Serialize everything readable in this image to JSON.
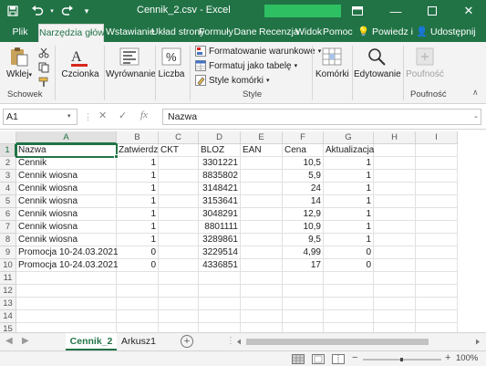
{
  "window": {
    "title": "Cennik_2.csv  -  Excel",
    "brand_color": "#217346"
  },
  "quick_access": {
    "save_icon": "save-icon",
    "undo_icon": "undo-icon",
    "redo_icon": "redo-icon",
    "customize_icon": "customize-quick-access-icon"
  },
  "ribbon_tabs": [
    {
      "label": "Plik",
      "active": false
    },
    {
      "label": "Narzędzia główne",
      "active": true
    },
    {
      "label": "Wstawianie",
      "active": false
    },
    {
      "label": "Układ strony",
      "active": false
    },
    {
      "label": "Formuły",
      "active": false
    },
    {
      "label": "Dane",
      "active": false
    },
    {
      "label": "Recenzja",
      "active": false
    },
    {
      "label": "Widok",
      "active": false
    },
    {
      "label": "Pomoc",
      "active": false
    }
  ],
  "tell_me": "Powiedz i",
  "share": "Udostępnij",
  "ribbon": {
    "paste": "Wklej",
    "clipboard_group": "Schowek",
    "font": "Czcionka",
    "alignment": "Wyrównanie",
    "number": "Liczba",
    "conditional_formatting": "Formatowanie warunkowe",
    "format_as_table": "Formatuj jako tabelę",
    "cell_styles": "Style komórki",
    "styles_group": "Style",
    "cells": "Komórki",
    "editing": "Edytowanie",
    "analysis": "Poufność",
    "sensitivity_group": "Poufność"
  },
  "formula_bar": {
    "name_box": "A1",
    "formula": "Nazwa",
    "cancel_icon": "cancel-icon",
    "enter_icon": "enter-icon",
    "fx_label": "fx"
  },
  "sheet": {
    "columns": [
      "A",
      "B",
      "C",
      "D",
      "E",
      "F",
      "G",
      "H",
      "I"
    ],
    "rows": [
      {
        "n": "1",
        "cells": [
          "Nazwa",
          "Zatwierdz",
          "CKT",
          "BLOZ",
          "EAN",
          "Cena",
          "Aktualizacja",
          "",
          ""
        ]
      },
      {
        "n": "2",
        "cells": [
          "Cennik",
          "1",
          "",
          "3301221",
          "",
          "10,5",
          "1",
          "",
          ""
        ]
      },
      {
        "n": "3",
        "cells": [
          "Cennik wiosna",
          "1",
          "",
          "8835802",
          "",
          "5,9",
          "1",
          "",
          ""
        ]
      },
      {
        "n": "4",
        "cells": [
          "Cennik wiosna",
          "1",
          "",
          "3148421",
          "",
          "24",
          "1",
          "",
          ""
        ]
      },
      {
        "n": "5",
        "cells": [
          "Cennik wiosna",
          "1",
          "",
          "3153641",
          "",
          "14",
          "1",
          "",
          ""
        ]
      },
      {
        "n": "6",
        "cells": [
          "Cennik wiosna",
          "1",
          "",
          "3048291",
          "",
          "12,9",
          "1",
          "",
          ""
        ]
      },
      {
        "n": "7",
        "cells": [
          "Cennik wiosna",
          "1",
          "",
          "8801111",
          "",
          "10,9",
          "1",
          "",
          ""
        ]
      },
      {
        "n": "8",
        "cells": [
          "Cennik wiosna",
          "1",
          "",
          "3289861",
          "",
          "9,5",
          "1",
          "",
          ""
        ]
      },
      {
        "n": "9",
        "cells": [
          "Promocja 10-24.03.2021",
          "0",
          "",
          "3229514",
          "",
          "4,99",
          "0",
          "",
          ""
        ]
      },
      {
        "n": "10",
        "cells": [
          "Promocja 10-24.03.2021",
          "0",
          "",
          "4336851",
          "",
          "17",
          "0",
          "",
          ""
        ]
      },
      {
        "n": "11",
        "cells": [
          "",
          "",
          "",
          "",
          "",
          "",
          "",
          "",
          ""
        ]
      },
      {
        "n": "12",
        "cells": [
          "",
          "",
          "",
          "",
          "",
          "",
          "",
          "",
          ""
        ]
      },
      {
        "n": "13",
        "cells": [
          "",
          "",
          "",
          "",
          "",
          "",
          "",
          "",
          ""
        ]
      },
      {
        "n": "14",
        "cells": [
          "",
          "",
          "",
          "",
          "",
          "",
          "",
          "",
          ""
        ]
      },
      {
        "n": "15",
        "cells": [
          "",
          "",
          "",
          "",
          "",
          "",
          "",
          "",
          ""
        ]
      }
    ]
  },
  "sheet_tabs": [
    {
      "label": "Cennik_2",
      "active": true
    },
    {
      "label": "Arkusz1",
      "active": false
    }
  ],
  "status_bar": {
    "zoom": "100%"
  }
}
